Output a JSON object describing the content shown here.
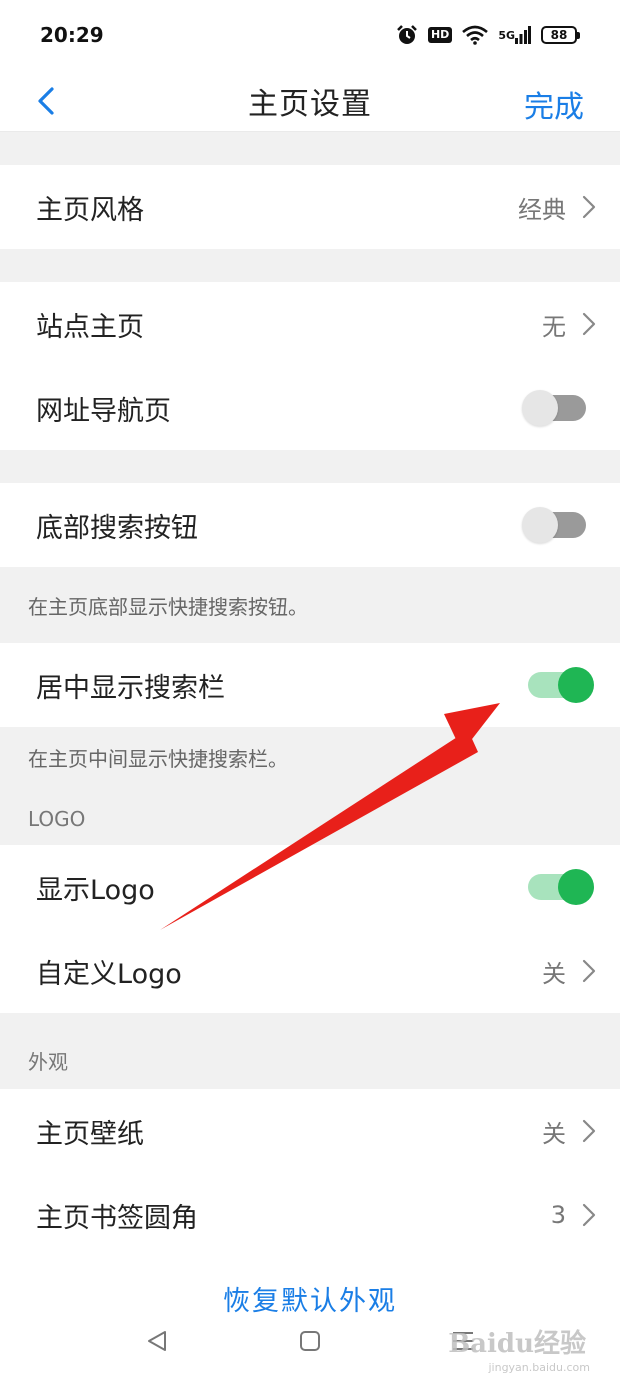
{
  "status_bar": {
    "time": "20:29",
    "icons": [
      "alarm-icon",
      "hd-icon",
      "wifi-icon",
      "5g-signal-icon",
      "battery-icon"
    ],
    "hd": "HD",
    "network": "5G",
    "battery": "88"
  },
  "header": {
    "back_icon": "chevron-left-icon",
    "title": "主页设置",
    "done_label": "完成"
  },
  "rows": {
    "home_style": {
      "label": "主页风格",
      "value": "经典"
    },
    "site_home": {
      "label": "站点主页",
      "value": "无"
    },
    "url_nav": {
      "label": "网址导航页",
      "toggle": "off"
    },
    "bottom_search": {
      "label": "底部搜索按钮",
      "toggle": "off",
      "note": "在主页底部显示快捷搜索按钮。"
    },
    "center_search": {
      "label": "居中显示搜索栏",
      "toggle": "on",
      "note": "在主页中间显示快捷搜索栏。"
    },
    "show_logo": {
      "label": "显示Logo",
      "toggle": "on"
    },
    "custom_logo": {
      "label": "自定义Logo",
      "value": "关"
    },
    "wallpaper": {
      "label": "主页壁纸",
      "value": "关"
    },
    "bookmark_radius": {
      "label": "主页书签圆角",
      "value": "3"
    }
  },
  "sections": {
    "logo": "LOGO",
    "appearance": "外观"
  },
  "restore_label": "恢复默认外观",
  "system_nav": [
    "back-triangle-icon",
    "home-square-icon",
    "menu-lines-icon"
  ],
  "watermark": {
    "text": "Baidu经验",
    "sub": "jingyan.baidu.com"
  },
  "colors": {
    "accent": "#1a7ee6",
    "toggle_on": "#1fb654",
    "toggle_on_track": "#a8e3bd",
    "toggle_off_track": "#9a9a9a",
    "arrow": "#e8201a"
  }
}
